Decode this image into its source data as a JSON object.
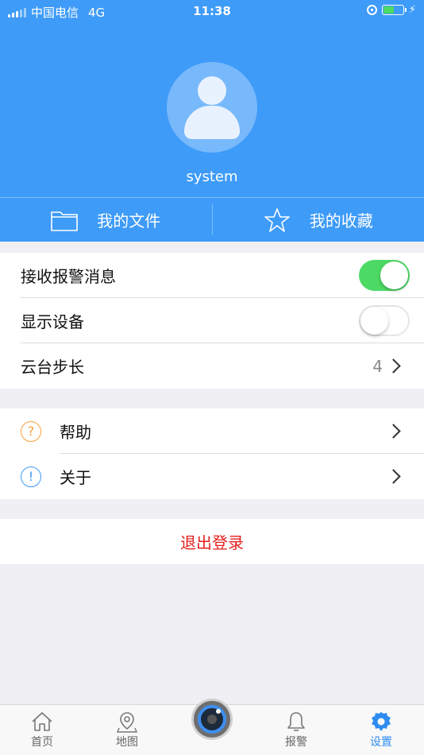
{
  "status_bar": {
    "carrier": "中国电信",
    "network": "4G",
    "time": "11:38",
    "charging_icon": "⚡"
  },
  "profile": {
    "username": "system"
  },
  "quick_actions": {
    "files_label": "我的文件",
    "favorites_label": "我的收藏"
  },
  "settings": {
    "alarm_messages": {
      "label": "接收报警消息",
      "enabled": true
    },
    "show_devices": {
      "label": "显示设备",
      "enabled": false
    },
    "ptz_step": {
      "label": "云台步长",
      "value": "4"
    }
  },
  "misc": {
    "help": {
      "label": "帮助",
      "icon": "?"
    },
    "about": {
      "label": "关于",
      "icon": "!"
    }
  },
  "logout_label": "退出登录",
  "tabs": {
    "home": "首页",
    "map": "地图",
    "alarm": "报警",
    "settings": "设置"
  },
  "colors": {
    "primary": "#3e9bf8",
    "toggle_on": "#4cd964",
    "logout": "#e5201f",
    "help_icon": "#f5a23a",
    "about_icon": "#3e9bf8",
    "tab_active": "#2e8cf0"
  }
}
